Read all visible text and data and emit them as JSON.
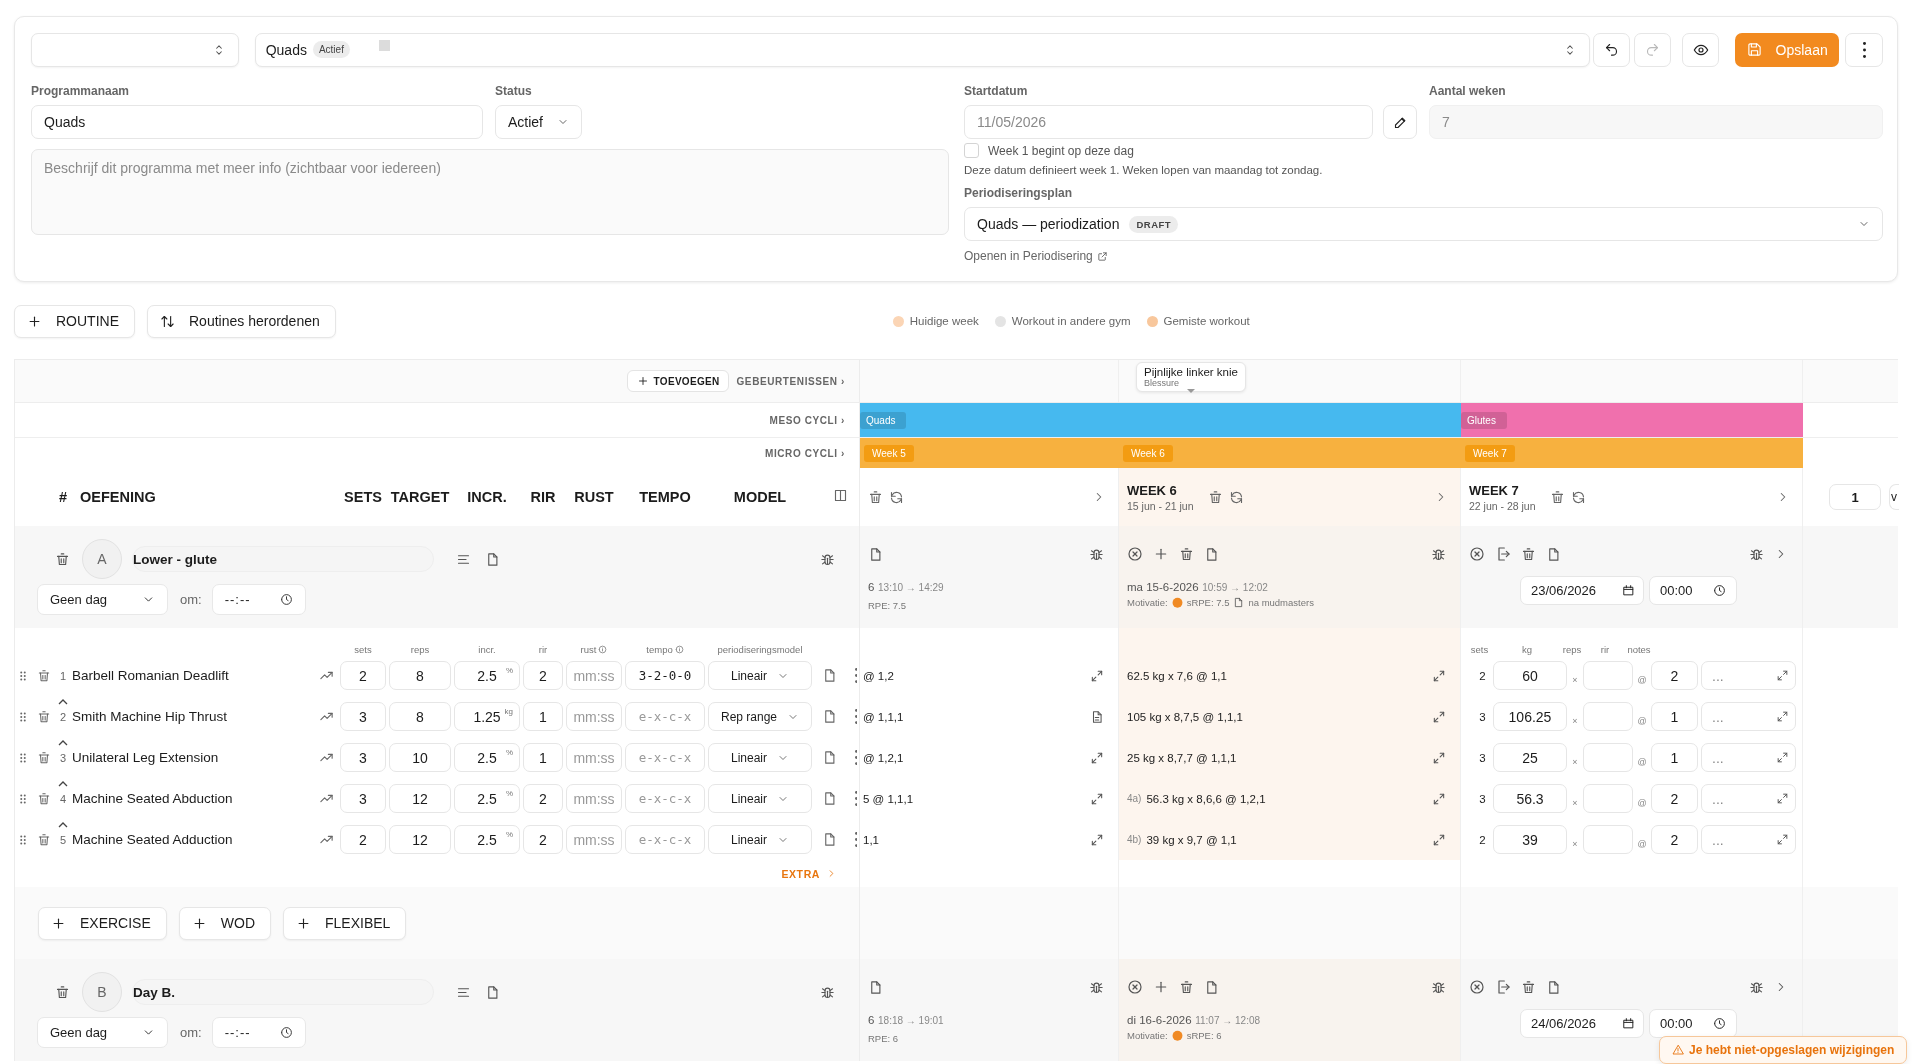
{
  "toolbar": {
    "program": "Quads",
    "program_badge": "Actief",
    "save": "Opslaan",
    "redo_disabled": true
  },
  "form": {
    "name_label": "Programmanaam",
    "name": "Quads",
    "status_label": "Status",
    "status": "Actief",
    "description_placeholder": "Beschrijf dit programma met meer info (zichtbaar voor iedereen)",
    "start_label": "Startdatum",
    "start_date": "11/05/2026",
    "weeks_label": "Aantal weken",
    "weeks": "7",
    "week1": {
      "label": "Week 1 begint op deze dag",
      "checked": false
    },
    "hint": "Deze datum definieert week 1. Weken lopen van maandag tot zondag.",
    "plan_label": "Periodiseringsplan",
    "plan": "Quads — periodization",
    "plan_badge": "DRAFT",
    "plan_link": "Openen in Periodisering"
  },
  "actions": [
    "ROUTINE",
    "Routines herordenen"
  ],
  "legend": [
    {
      "label": "Huidige week",
      "color": "#fbd5b5"
    },
    {
      "label": "Workout in andere gym",
      "color": "#e4e4e4"
    },
    {
      "label": "Gemiste workout",
      "color": "#f8c79c"
    }
  ],
  "planner": {
    "add_event": "TOEVOEGEN",
    "events_label": "GEBEURTENISSEN ›",
    "meso_label": "MESO CYCLI ›",
    "micro_label": "MICRO CYCLI ›",
    "columns": [
      "#",
      "OEFENING",
      "SETS",
      "TARGET",
      "INCR.",
      "RIR",
      "RUST",
      "TEMPO",
      "MODEL"
    ],
    "subheaders": [
      "sets",
      "reps",
      "incr.",
      "rir",
      "rust",
      "tempo",
      "periodiseringsmodel"
    ],
    "entry_headers": [
      "sets",
      "kg",
      "reps",
      "rir",
      "notes"
    ],
    "weeks": [
      {
        "micro": "Week 5",
        "current": false,
        "meso": {
          "label": "Quads",
          "color": "#46b9ef"
        }
      },
      {
        "title": "WEEK 6",
        "dates": "15 jun - 21 jun",
        "micro": "Week 6",
        "current": true,
        "meso": {
          "color": "#46b9ef"
        },
        "event": {
          "title": "Pijnlijke linker knie",
          "type": "Blessure"
        }
      },
      {
        "title": "WEEK 7",
        "dates": "22 jun - 28 jun",
        "micro": "Week 7",
        "current": false,
        "meso": {
          "label": "Glutes",
          "color": "#f070ad"
        }
      }
    ],
    "page": "1",
    "next_cut": "v",
    "extra": "EXTRA",
    "add_buttons": [
      "EXERCISE",
      "WOD",
      "FLEXIBEL"
    ],
    "routines": [
      {
        "letter": "A",
        "name": "Lower - glute",
        "day": "Geen dag",
        "at": "om:",
        "time": "--:--",
        "sessions": [
          {
            "kind": "clipped",
            "date": "6",
            "time": "13:10 → 14:29",
            "rpe": "RPE: 7.5"
          },
          {
            "kind": "done",
            "date": "ma 15-6-2026",
            "time": "10:59 → 12:02",
            "motivation": "Motivatie:",
            "rpe": "sRPE: 7.5",
            "note": "na mudmasters"
          },
          {
            "kind": "planned",
            "date": "23/06/2026",
            "time": "00:00"
          }
        ],
        "exercises": [
          {
            "num": "1",
            "name": "Barbell Romanian Deadlift",
            "linked": false,
            "sets": "2",
            "reps": "8",
            "incr": "2.5",
            "unit": "%",
            "rir": "2",
            "rust": "mm:ss",
            "tempo": {
              "value": "3-2-0-0"
            },
            "model": "Lineair",
            "results": [
              {
                "text": "@ 1,2",
                "note": false
              },
              {
                "text": "62.5 kg x 7,6 @ 1,1"
              },
              {
                "sets": "2",
                "kg": "60",
                "times": "×",
                "at": "@",
                "rir": "2",
                "notes": "..."
              }
            ]
          },
          {
            "num": "2",
            "name": "Smith Machine Hip Thrust",
            "linked": true,
            "sets": "3",
            "reps": "8",
            "incr": "1.25",
            "unit": "kg",
            "rir": "1",
            "rust": "mm:ss",
            "tempo": {
              "placeholder": "e-x-c-x"
            },
            "model": "Rep range",
            "results": [
              {
                "text": "@ 1,1,1",
                "note": true
              },
              {
                "text": "105 kg x 8,7,5 @ 1,1,1"
              },
              {
                "sets": "3",
                "kg": "106.25",
                "times": "×",
                "at": "@",
                "rir": "1",
                "notes": "..."
              }
            ]
          },
          {
            "num": "3",
            "name": "Unilateral Leg Extension",
            "linked": true,
            "sets": "3",
            "reps": "10",
            "incr": "2.5",
            "unit": "%",
            "rir": "1",
            "rust": "mm:ss",
            "tempo": {
              "placeholder": "e-x-c-x"
            },
            "model": "Lineair",
            "results": [
              {
                "text": "@ 1,2,1",
                "note": false
              },
              {
                "text": "25 kg x 8,7,7 @ 1,1,1"
              },
              {
                "sets": "3",
                "kg": "25",
                "times": "×",
                "at": "@",
                "rir": "1",
                "notes": "..."
              }
            ]
          },
          {
            "num": "4",
            "name": "Machine Seated Abduction",
            "linked": true,
            "sets": "3",
            "reps": "12",
            "incr": "2.5",
            "unit": "%",
            "rir": "2",
            "rust": "mm:ss",
            "tempo": {
              "placeholder": "e-x-c-x"
            },
            "model": "Lineair",
            "results": [
              {
                "text": "5 @ 1,1,1",
                "note": false
              },
              {
                "prefix": "4a)",
                "text": "56.3 kg x 8,6,6 @ 1,2,1"
              },
              {
                "sets": "3",
                "kg": "56.3",
                "times": "×",
                "at": "@",
                "rir": "2",
                "notes": "..."
              }
            ]
          },
          {
            "num": "5",
            "name": "Machine Seated Adduction",
            "linked": true,
            "sets": "2",
            "reps": "12",
            "incr": "2.5",
            "unit": "%",
            "rir": "2",
            "rust": "mm:ss",
            "tempo": {
              "placeholder": "e-x-c-x"
            },
            "model": "Lineair",
            "results": [
              {
                "text": "1,1",
                "note": false
              },
              {
                "prefix": "4b)",
                "text": "39 kg x 9,7 @ 1,1"
              },
              {
                "sets": "2",
                "kg": "39",
                "times": "×",
                "at": "@",
                "rir": "2",
                "notes": "..."
              }
            ]
          }
        ]
      },
      {
        "letter": "B",
        "name": "Day B.",
        "day": "Geen dag",
        "at": "om:",
        "time": "--:--",
        "sessions": [
          {
            "kind": "clipped",
            "date": "6",
            "time": "18:18 → 19:01",
            "rpe": "RPE: 6"
          },
          {
            "kind": "done",
            "date": "di 16-6-2026",
            "time": "11:07 → 12:08",
            "motivation": "Motivatie:",
            "rpe": "sRPE: 6"
          },
          {
            "kind": "planned",
            "date": "24/06/2026",
            "time": "00:00"
          }
        ]
      }
    ]
  },
  "toast": "Je hebt niet-opgeslagen wijzigingen"
}
